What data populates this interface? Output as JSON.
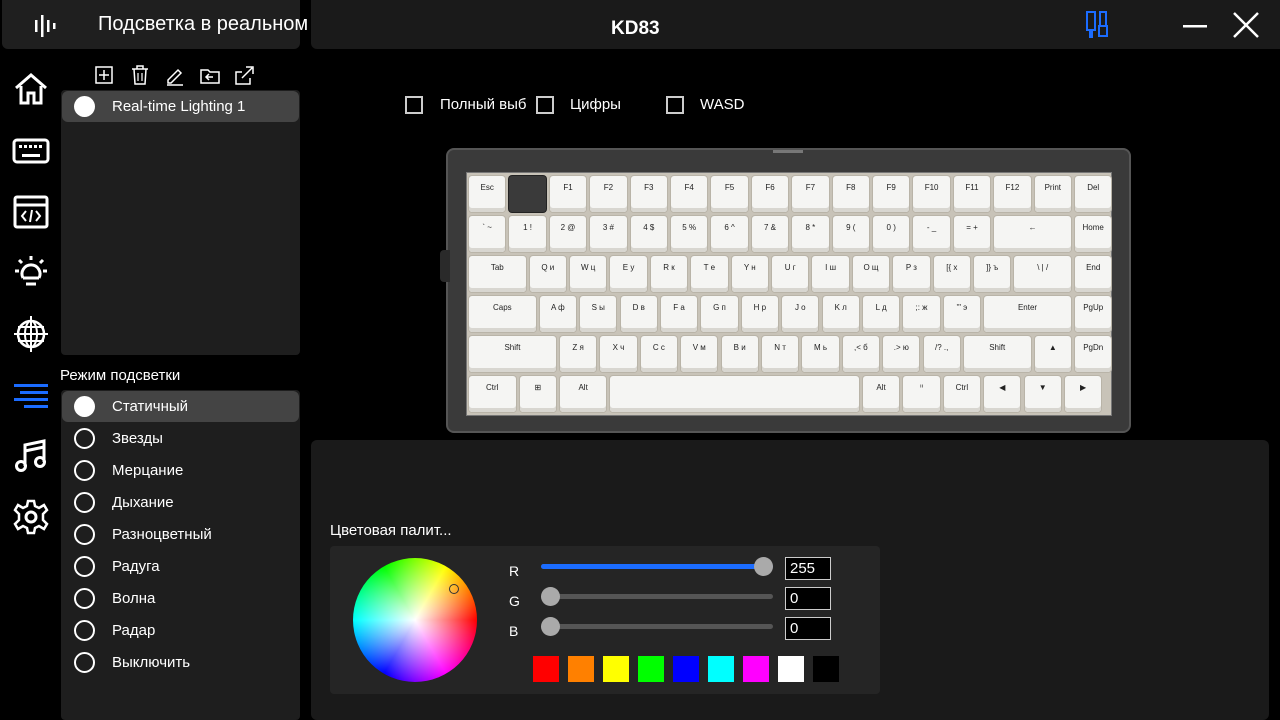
{
  "header": {
    "profile_title": "Подсветка в реальном вр...",
    "device_name": "KD83"
  },
  "nav": [
    "home-icon",
    "keyboard-icon",
    "macro-icon",
    "light-icon",
    "globe-icon",
    "lighting-mode-icon",
    "music-icon",
    "settings-icon"
  ],
  "profiles": {
    "items": [
      {
        "label": "Real-time Lighting 1",
        "selected": true
      }
    ]
  },
  "modes": {
    "heading": "Режим подсветки",
    "items": [
      {
        "label": "Статичный",
        "selected": true
      },
      {
        "label": "Звезды"
      },
      {
        "label": "Мерцание"
      },
      {
        "label": "Дыхание"
      },
      {
        "label": "Разноцветный"
      },
      {
        "label": "Радуга"
      },
      {
        "label": "Волна"
      },
      {
        "label": "Радар"
      },
      {
        "label": "Выключить"
      }
    ]
  },
  "selection": {
    "full": "Полный выб",
    "digits": "Цифры",
    "wasd": "WASD"
  },
  "keyboard": {
    "rows": [
      [
        "Esc",
        "",
        "F1",
        "F2",
        "F3",
        "F4",
        "F5",
        "F6",
        "F7",
        "F8",
        "F9",
        "F10",
        "F11",
        "F12",
        "Print",
        "Del"
      ],
      [
        "` ~",
        "1 !",
        "2 @",
        "3 #",
        "4 $",
        "5 %",
        "6 ^",
        "7 &",
        "8 *",
        "9 (",
        "0 )",
        "- _",
        "= +",
        "←",
        "Home"
      ],
      [
        "Tab",
        "Q и",
        "W ц",
        "E у",
        "R к",
        "T е",
        "Y н",
        "U г",
        "I ш",
        "O щ",
        "P з",
        "[{ х",
        "]} ъ",
        "\\ | /",
        "End"
      ],
      [
        "Caps",
        "A ф",
        "S ы",
        "D в",
        "F а",
        "G п",
        "H р",
        "J о",
        "K л",
        "L д",
        ";: ж",
        "'\" э",
        "Enter",
        "PgUp"
      ],
      [
        "Shift",
        "Z я",
        "X ч",
        "C с",
        "V м",
        "B и",
        "N т",
        "M ь",
        ",< б",
        ".> ю",
        "/? .,",
        "Shift",
        "▲",
        "PgDn"
      ],
      [
        "Ctrl",
        "⊞",
        "Alt",
        "",
        "Alt",
        "ᑊᑊ",
        "Ctrl",
        "◀",
        "▼",
        "▶"
      ]
    ]
  },
  "palette": {
    "title": "Цветовая палит...",
    "r_label": "R",
    "g_label": "G",
    "b_label": "B",
    "r": "255",
    "g": "0",
    "b": "0",
    "r_fraction": 1.0,
    "g_fraction": 0.0,
    "b_fraction": 0.0,
    "swatches": [
      "#ff0000",
      "#ff8000",
      "#ffff00",
      "#00ff00",
      "#0000ff",
      "#00ffff",
      "#ff00ff",
      "#ffffff",
      "#000000"
    ]
  },
  "colors": {
    "accent": "#1b6cff",
    "panel": "#1e1e1e",
    "selected": "#444444"
  }
}
